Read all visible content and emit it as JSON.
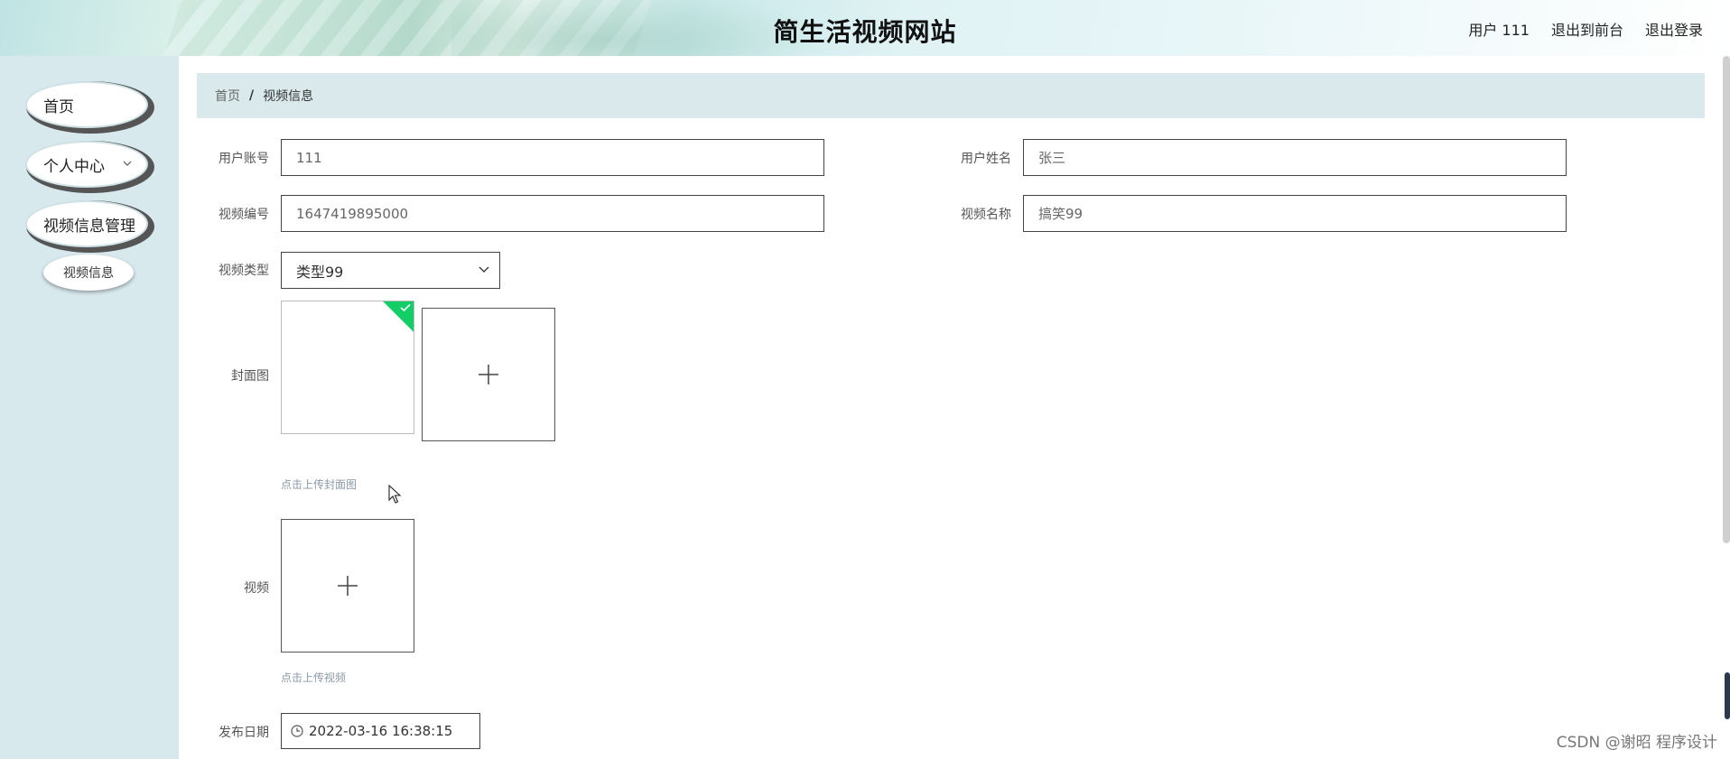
{
  "header": {
    "title": "简生活视频网站",
    "user_label": "用户 111",
    "back_to_front": "退出到前台",
    "logout": "退出登录"
  },
  "sidebar": {
    "items": [
      {
        "label": "首页"
      },
      {
        "label": "个人中心"
      },
      {
        "label": "视频信息管理"
      }
    ],
    "subitems": [
      {
        "label": "视频信息"
      }
    ]
  },
  "breadcrumb": {
    "home": "首页",
    "separator": "/",
    "current": "视频信息"
  },
  "form": {
    "account_label": "用户账号",
    "account_value": "111",
    "username_label": "用户姓名",
    "username_value": "张三",
    "video_no_label": "视频编号",
    "video_no_value": "1647419895000",
    "video_name_label": "视频名称",
    "video_name_value": "搞笑99",
    "video_type_label": "视频类型",
    "video_type_value": "类型99",
    "cover_label": "封面图",
    "cover_hint": "点击上传封面图",
    "video_label": "视频",
    "video_hint": "点击上传视频",
    "publish_date_label": "发布日期",
    "publish_date_value": "2022-03-16 16:38:15"
  },
  "watermark": "CSDN @谢昭  程序设计",
  "colors": {
    "sidebar_bg": "#d8e9ee",
    "breadcrumb_bg": "#d9e9ec",
    "upload_success": "#13ce66"
  }
}
